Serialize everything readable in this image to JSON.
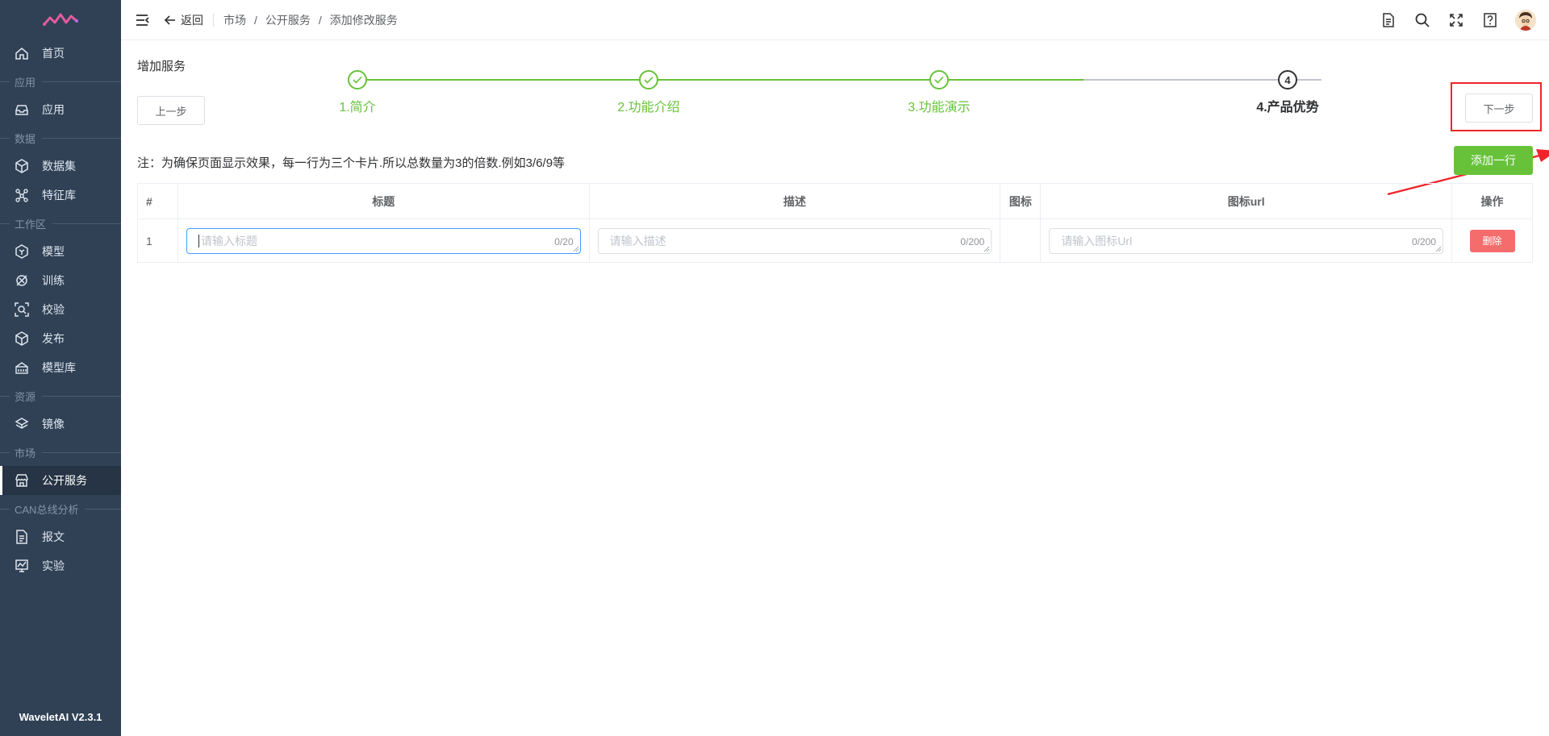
{
  "sidebar": {
    "version": "WaveletAI V2.3.1",
    "items": [
      {
        "label": "首页",
        "icon": "home-icon"
      },
      {
        "group": "应用"
      },
      {
        "label": "应用",
        "icon": "inbox-icon"
      },
      {
        "group": "数据"
      },
      {
        "label": "数据集",
        "icon": "cube-icon"
      },
      {
        "label": "特征库",
        "icon": "molecule-icon"
      },
      {
        "group": "工作区"
      },
      {
        "label": "模型",
        "icon": "model-icon"
      },
      {
        "label": "训练",
        "icon": "train-icon"
      },
      {
        "label": "校验",
        "icon": "verify-icon"
      },
      {
        "label": "发布",
        "icon": "publish-icon"
      },
      {
        "label": "模型库",
        "icon": "library-icon"
      },
      {
        "group": "资源"
      },
      {
        "label": "镜像",
        "icon": "mirror-icon"
      },
      {
        "group": "市场"
      },
      {
        "label": "公开服务",
        "icon": "shop-icon",
        "active": true
      },
      {
        "group": "CAN总线分析"
      },
      {
        "label": "报文",
        "icon": "document-icon"
      },
      {
        "label": "实验",
        "icon": "experiment-icon"
      }
    ]
  },
  "header": {
    "back": "返回",
    "breadcrumb": [
      "市场",
      "公开服务",
      "添加修改服务"
    ]
  },
  "main": {
    "title": "增加服务",
    "prev_button": "上一步",
    "next_button": "下一步",
    "add_row_button": "添加一行",
    "note": "注：为确保页面显示效果，每一行为三个卡片.所以总数量为3的倍数.例如3/6/9等",
    "steps": [
      {
        "label": "1.简介",
        "status": "done"
      },
      {
        "label": "2.功能介绍",
        "status": "done"
      },
      {
        "label": "3.功能演示",
        "status": "done"
      },
      {
        "label": "4.产品优势",
        "status": "current",
        "number": "4"
      }
    ],
    "table": {
      "headers": [
        "#",
        "标题",
        "描述",
        "图标",
        "图标url",
        "操作"
      ],
      "rows": [
        {
          "index": "1",
          "title_placeholder": "请输入标题",
          "title_count": "0/20",
          "desc_placeholder": "请输入描述",
          "desc_count": "0/200",
          "url_placeholder": "请输入图标Url",
          "url_count": "0/200",
          "delete": "删除"
        }
      ]
    }
  },
  "colors": {
    "sidebar_bg": "#304156",
    "success": "#67c23a",
    "danger": "#f56c6c",
    "highlight_red": "#f0232b"
  }
}
